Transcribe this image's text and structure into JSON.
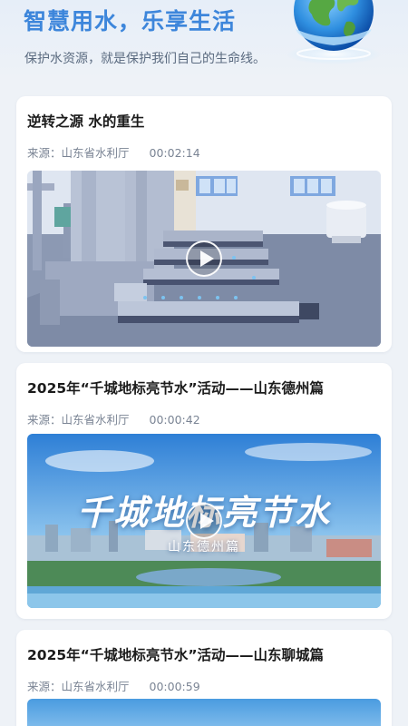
{
  "header": {
    "title": "智慧用水，乐享生活",
    "subtitle": "保护水资源，就是保护我们自己的生命线。"
  },
  "colors": {
    "accent": "#3d86db",
    "page_bg": "#eef2f7",
    "card_bg": "#ffffff"
  },
  "videos": [
    {
      "title": "逆转之源 水的重生",
      "source": "来源：山东省水利厅",
      "duration": "00:02:14"
    },
    {
      "title": "2025年“千城地标亮节水”活动——山东德州篇",
      "source": "来源：山东省水利厅",
      "duration": "00:00:42",
      "overlay_title": "千城地标亮节水",
      "overlay_subtitle": "山东德州篇"
    },
    {
      "title": "2025年“千城地标亮节水”活动——山东聊城篇",
      "source": "来源：山东省水利厅",
      "duration": "00:00:59"
    }
  ]
}
